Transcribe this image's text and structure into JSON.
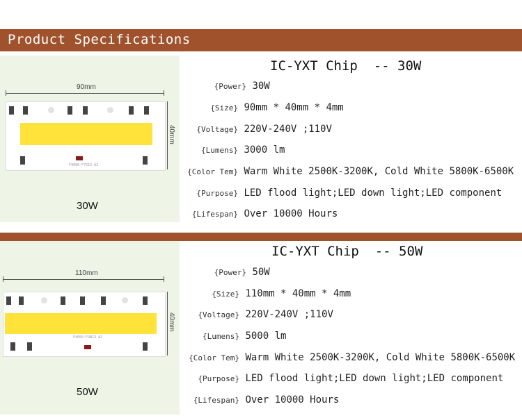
{
  "header": {
    "title": "Product Specifications"
  },
  "products": [
    {
      "title": "IC-YXT Chip  -- 30W",
      "width_label": "90mm",
      "height_label": "40mm",
      "board_marking": "F4090-F7513 A2",
      "watt_label": "30W",
      "specs": [
        {
          "label": "{Power}",
          "value": "30W"
        },
        {
          "label": "{Size}",
          "value": "90mm * 40mm * 4mm"
        },
        {
          "label": "{Voltage}",
          "value": "220V-240V ;110V"
        },
        {
          "label": "{Lumens}",
          "value": "3000 lm"
        },
        {
          "label": "{Color Tem}",
          "value": "Warm White 2500K-3200K, Cold White 5800K-6500K"
        },
        {
          "label": "{Purpose}",
          "value": "LED flood light;LED down light;LED component"
        },
        {
          "label": "{Lifespan}",
          "value": "Over 10000 Hours"
        }
      ]
    },
    {
      "title": "IC-YXT Chip  -- 50W",
      "width_label": "110mm",
      "height_label": "40mm",
      "board_marking": "F4050-F4813 A2",
      "watt_label": "50W",
      "specs": [
        {
          "label": "{Power}",
          "value": "50W"
        },
        {
          "label": "{Size}",
          "value": "110mm * 40mm * 4mm"
        },
        {
          "label": "{Voltage}",
          "value": "220V-240V ;110V"
        },
        {
          "label": "{Lumens}",
          "value": "5000 lm"
        },
        {
          "label": "{Color Tem}",
          "value": "Warm White 2500K-3200K, Cold White 5800K-6500K"
        },
        {
          "label": "{Purpose}",
          "value": "LED flood light;LED down light;LED component"
        },
        {
          "label": "{Lifespan}",
          "value": "Over 10000 Hours"
        }
      ]
    }
  ]
}
